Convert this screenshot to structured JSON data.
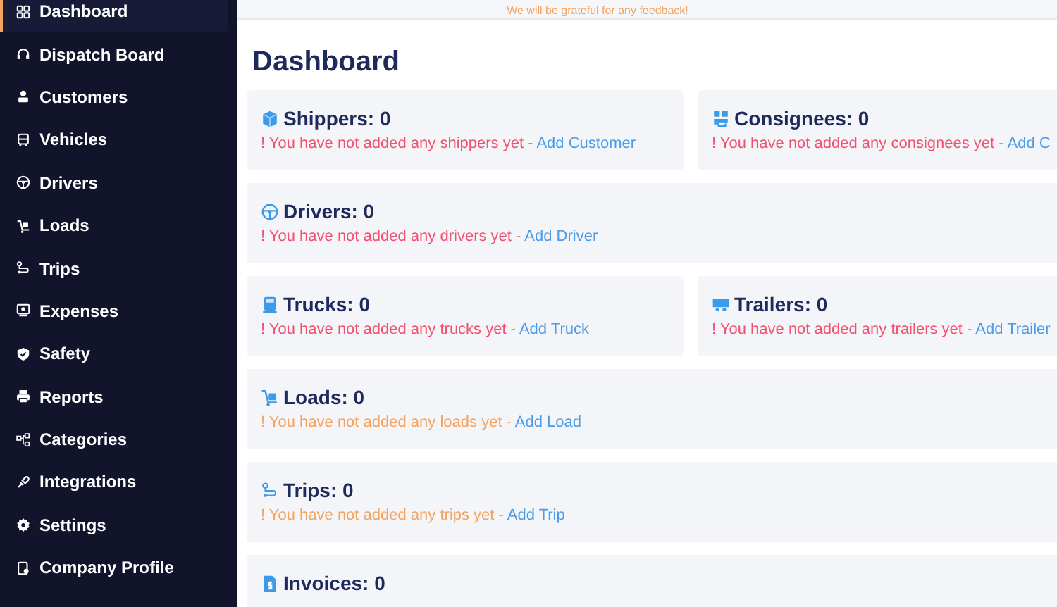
{
  "sidebar": {
    "items": [
      {
        "label": "Dashboard",
        "selected": true
      },
      {
        "label": "Dispatch Board",
        "selected": false
      },
      {
        "label": "Customers",
        "selected": false
      },
      {
        "label": "Vehicles",
        "selected": false
      },
      {
        "label": "Drivers",
        "selected": false
      },
      {
        "label": "Loads",
        "selected": false
      },
      {
        "label": "Trips",
        "selected": false
      },
      {
        "label": "Expenses",
        "selected": false
      },
      {
        "label": "Safety",
        "selected": false
      },
      {
        "label": "Reports",
        "selected": false
      },
      {
        "label": "Categories",
        "selected": false
      },
      {
        "label": "Integrations",
        "selected": false
      },
      {
        "label": "Settings",
        "selected": false
      },
      {
        "label": "Company Profile",
        "selected": false
      }
    ]
  },
  "banner": {
    "text": "We will be grateful for any feedback!"
  },
  "page_title": "Dashboard",
  "rows": [
    {
      "cards": [
        {
          "title": "Shippers: 0",
          "color": "#f2506e",
          "message": "! You have not added any shippers yet - ",
          "link": "Add Customer"
        },
        {
          "title": "Consignees: 0",
          "color": "#f2506e",
          "message": "! You have not added any consignees yet - ",
          "link": "Add C"
        }
      ]
    },
    {
      "cards": [
        {
          "title": "Drivers: 0",
          "color": "#f2506e",
          "message": "! You have not added any drivers yet - ",
          "link": "Add Driver"
        }
      ]
    },
    {
      "cards": [
        {
          "title": "Trucks: 0",
          "color": "#f2506e",
          "message": "! You have not added any trucks yet - ",
          "link": "Add Truck"
        },
        {
          "title": "Trailers: 0",
          "color": "#f2506e",
          "message": "! You have not added any trailers yet - ",
          "link": "Add Trailer"
        }
      ]
    },
    {
      "cards": [
        {
          "title": "Loads: 0",
          "color": "#f5a35c",
          "message": "! You have not added any loads yet - ",
          "link": "Add Load"
        }
      ]
    },
    {
      "cards": [
        {
          "title": "Trips: 0",
          "color": "#f5a35c",
          "message": "! You have not added any trips yet - ",
          "link": "Add Trip"
        }
      ]
    },
    {
      "cards": [
        {
          "title": "Invoices: 0"
        }
      ]
    }
  ]
}
